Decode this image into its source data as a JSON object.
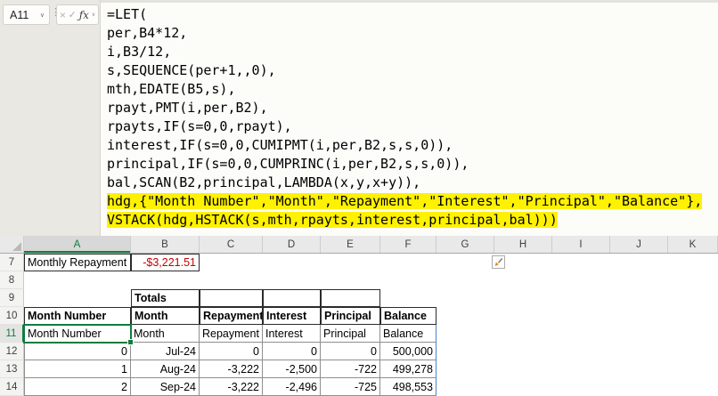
{
  "name_box": {
    "value": "A11"
  },
  "formula_bar": {
    "icons": {
      "name_box_dropdown": "∨",
      "drag_handle": "⋮",
      "cancel": "×",
      "enter": "✓",
      "insert_function": "ƒx",
      "fx_dropdown": "∨"
    }
  },
  "formula": {
    "lines": [
      {
        "text": "=LET(",
        "highlighted": false
      },
      {
        "text": "per,B4*12,",
        "highlighted": false
      },
      {
        "text": "i,B3/12,",
        "highlighted": false
      },
      {
        "text": "s,SEQUENCE(per+1,,0),",
        "highlighted": false
      },
      {
        "text": "mth,EDATE(B5,s),",
        "highlighted": false
      },
      {
        "text": "rpayt,PMT(i,per,B2),",
        "highlighted": false
      },
      {
        "text": "rpayts,IF(s=0,0,rpayt),",
        "highlighted": false
      },
      {
        "text": "interest,IF(s=0,0,CUMIPMT(i,per,B2,s,s,0)),",
        "highlighted": false
      },
      {
        "text": "principal,IF(s=0,0,CUMPRINC(i,per,B2,s,s,0)),",
        "highlighted": false
      },
      {
        "text": "bal,SCAN(B2,principal,LAMBDA(x,y,x+y)),",
        "highlighted": false
      },
      {
        "text": "hdg,{\"Month Number\",\"Month\",\"Repayment\",\"Interest\",\"Principal\",\"Balance\"},",
        "highlighted": true
      },
      {
        "text": "VSTACK(hdg,HSTACK(s,mth,rpayts,interest,principal,bal)))",
        "highlighted": true
      }
    ]
  },
  "grid": {
    "selection": {
      "active_cell": "A11",
      "col": "A",
      "row": "11"
    },
    "columns": [
      {
        "letter": "A",
        "selected": true
      },
      {
        "letter": "B",
        "selected": false
      },
      {
        "letter": "C",
        "selected": false
      },
      {
        "letter": "D",
        "selected": false
      },
      {
        "letter": "E",
        "selected": false
      },
      {
        "letter": "F",
        "selected": false
      },
      {
        "letter": "G",
        "selected": false
      },
      {
        "letter": "H",
        "selected": false
      },
      {
        "letter": "I",
        "selected": false
      },
      {
        "letter": "J",
        "selected": false
      },
      {
        "letter": "K",
        "selected": false
      }
    ],
    "rows": [
      {
        "num": "7",
        "selected": false,
        "cells": [
          {
            "col": "A",
            "text": "Monthly Repayment",
            "cls": "box"
          },
          {
            "col": "B",
            "text": "-$3,221.51",
            "cls": "box red num"
          }
        ]
      },
      {
        "num": "8",
        "selected": false,
        "cells": []
      },
      {
        "num": "9",
        "selected": false,
        "cells": [
          {
            "col": "B",
            "text": "Totals",
            "cls": "box bold"
          },
          {
            "col": "C",
            "text": "",
            "cls": "box"
          },
          {
            "col": "D",
            "text": "",
            "cls": "box"
          },
          {
            "col": "E",
            "text": "",
            "cls": "box"
          }
        ]
      },
      {
        "num": "10",
        "selected": false,
        "cells": [
          {
            "col": "A",
            "text": "Month Number",
            "cls": "box bold"
          },
          {
            "col": "B",
            "text": "Month",
            "cls": "box bold"
          },
          {
            "col": "C",
            "text": "Repayment",
            "cls": "box bold"
          },
          {
            "col": "D",
            "text": "Interest",
            "cls": "box bold"
          },
          {
            "col": "E",
            "text": "Principal",
            "cls": "box bold"
          },
          {
            "col": "F",
            "text": "Balance",
            "cls": "box bold"
          }
        ]
      },
      {
        "num": "11",
        "selected": true,
        "cells": [
          {
            "col": "A",
            "text": "Month Number",
            "cls": "thin edge-l"
          },
          {
            "col": "B",
            "text": "Month",
            "cls": "thin"
          },
          {
            "col": "C",
            "text": "Repayment",
            "cls": "thin"
          },
          {
            "col": "D",
            "text": "Interest",
            "cls": "thin"
          },
          {
            "col": "E",
            "text": "Principal",
            "cls": "thin"
          },
          {
            "col": "F",
            "text": "Balance",
            "cls": "thin spill-right"
          }
        ]
      },
      {
        "num": "12",
        "selected": false,
        "cells": [
          {
            "col": "A",
            "text": "0",
            "cls": "thin edge-l num"
          },
          {
            "col": "B",
            "text": "Jul-24",
            "cls": "thin num"
          },
          {
            "col": "C",
            "text": "0",
            "cls": "thin num"
          },
          {
            "col": "D",
            "text": "0",
            "cls": "thin num"
          },
          {
            "col": "E",
            "text": "0",
            "cls": "thin num"
          },
          {
            "col": "F",
            "text": "500,000",
            "cls": "thin num spill-right"
          }
        ]
      },
      {
        "num": "13",
        "selected": false,
        "cells": [
          {
            "col": "A",
            "text": "1",
            "cls": "thin edge-l num"
          },
          {
            "col": "B",
            "text": "Aug-24",
            "cls": "thin num"
          },
          {
            "col": "C",
            "text": "-3,222",
            "cls": "thin num"
          },
          {
            "col": "D",
            "text": "-2,500",
            "cls": "thin num"
          },
          {
            "col": "E",
            "text": "-722",
            "cls": "thin num"
          },
          {
            "col": "F",
            "text": "499,278",
            "cls": "thin num spill-right"
          }
        ]
      },
      {
        "num": "14",
        "selected": false,
        "cells": [
          {
            "col": "A",
            "text": "2",
            "cls": "thin edge-l num"
          },
          {
            "col": "B",
            "text": "Sep-24",
            "cls": "thin num"
          },
          {
            "col": "C",
            "text": "-3,222",
            "cls": "thin num"
          },
          {
            "col": "D",
            "text": "-2,496",
            "cls": "thin num"
          },
          {
            "col": "E",
            "text": "-725",
            "cls": "thin num"
          },
          {
            "col": "F",
            "text": "498,553",
            "cls": "thin num spill-right"
          }
        ]
      }
    ],
    "smart_tag_icon": "format-brush-icon"
  },
  "colors": {
    "selection_green": "#107C41",
    "negative_red": "#C00000",
    "highlight_yellow": "#FFF200",
    "spill_blue": "#4A86C8"
  }
}
